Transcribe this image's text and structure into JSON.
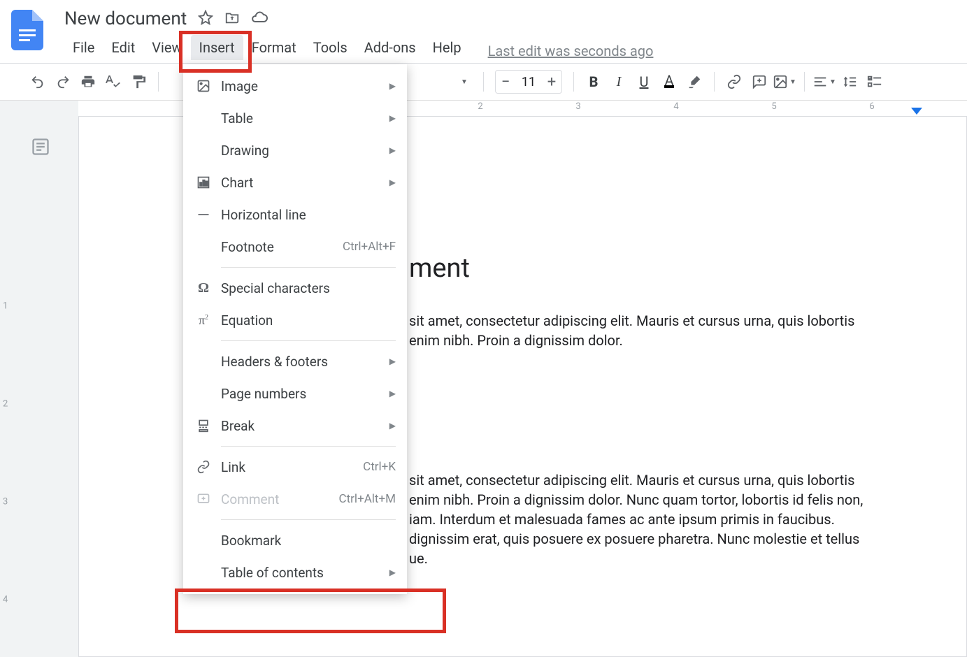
{
  "header": {
    "title": "New document",
    "menus": [
      "File",
      "Edit",
      "View",
      "Insert",
      "Format",
      "Tools",
      "Add-ons",
      "Help"
    ],
    "active_menu": "Insert",
    "last_edit": "Last edit was seconds ago"
  },
  "toolbar": {
    "font_size": "11"
  },
  "dropdown": {
    "items": [
      {
        "icon": "image",
        "label": "Image",
        "sub": true
      },
      {
        "icon": "table",
        "label": "Table",
        "sub": true
      },
      {
        "icon": "",
        "label": "Drawing",
        "sub": true
      },
      {
        "icon": "chart",
        "label": "Chart",
        "sub": true
      },
      {
        "icon": "hr",
        "label": "Horizontal line"
      },
      {
        "icon": "",
        "label": "Footnote",
        "shortcut": "Ctrl+Alt+F"
      },
      {
        "divider": true
      },
      {
        "icon": "omega",
        "label": "Special characters"
      },
      {
        "icon": "pi",
        "label": "Equation"
      },
      {
        "divider": true
      },
      {
        "icon": "",
        "label": "Headers & footers",
        "sub": true
      },
      {
        "icon": "",
        "label": "Page numbers",
        "sub": true
      },
      {
        "icon": "break",
        "label": "Break",
        "sub": true
      },
      {
        "divider": true
      },
      {
        "icon": "link",
        "label": "Link",
        "shortcut": "Ctrl+K"
      },
      {
        "icon": "comment",
        "label": "Comment",
        "shortcut": "Ctrl+Alt+M",
        "disabled": true
      },
      {
        "divider": true
      },
      {
        "icon": "",
        "label": "Bookmark"
      },
      {
        "icon": "",
        "label": "Table of contents",
        "sub": true
      }
    ]
  },
  "ruler": {
    "h": [
      2,
      3,
      4,
      5,
      6
    ],
    "v": [
      1,
      2,
      3,
      4
    ]
  },
  "document": {
    "heading_tail": "ment",
    "para1_lines": [
      "sit amet, consectetur adipiscing elit. Mauris et cursus urna, quis lobortis",
      "enim nibh. Proin a dignissim dolor."
    ],
    "para2_lines": [
      "sit amet, consectetur adipiscing elit. Mauris et cursus urna, quis lobortis",
      "enim nibh. Proin a dignissim dolor. Nunc quam tortor, lobortis id felis non,",
      "iam. Interdum et malesuada fames ac ante ipsum primis in faucibus.",
      "dignissim erat, quis posuere ex posuere pharetra. Nunc molestie et tellus",
      "ue."
    ]
  }
}
